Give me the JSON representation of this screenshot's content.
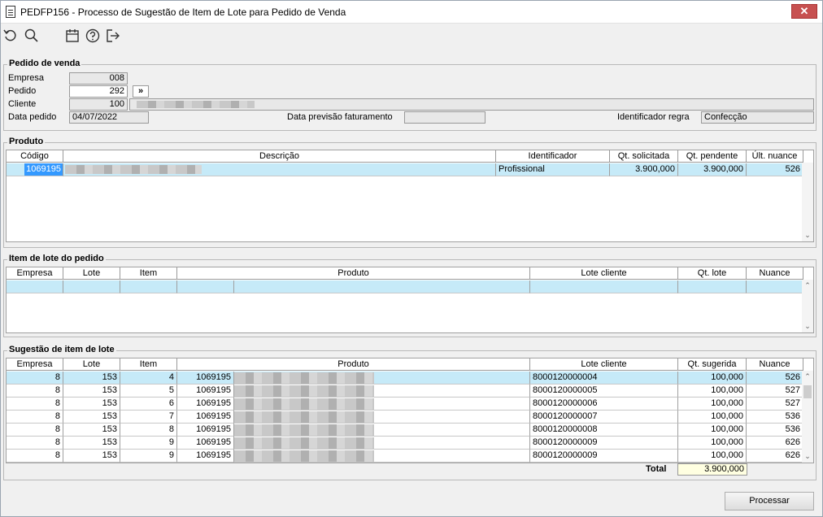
{
  "window": {
    "title": "PEDFP156 - Processo de Sugestão de Item de Lote para Pedido de Venda",
    "close": "✕"
  },
  "pedido": {
    "legend": "Pedido de venda",
    "empresa_label": "Empresa",
    "empresa_value": "008",
    "pedido_label": "Pedido",
    "pedido_value": "292",
    "pedido_btn": "»",
    "cliente_label": "Cliente",
    "cliente_value": "100",
    "data_label": "Data pedido",
    "data_value": "04/07/2022",
    "previsao_label": "Data previsão faturamento",
    "regra_label": "Identificador regra",
    "regra_value": "Confecção"
  },
  "produto": {
    "legend": "Produto",
    "headers": [
      "Código",
      "Descrição",
      "Identificador",
      "Qt. solicitada",
      "Qt. pendente",
      "Últ. nuance"
    ],
    "row": {
      "codigo": "1069195",
      "identificador": "Profissional",
      "solicitada": "3.900,000",
      "pendente": "3.900,000",
      "nuance": "526"
    }
  },
  "item_lote": {
    "legend": "Item de lote do pedido",
    "headers": [
      "Empresa",
      "Lote",
      "Item",
      "Produto",
      "Lote cliente",
      "Qt. lote",
      "Nuance"
    ]
  },
  "sugestao": {
    "legend": "Sugestão de item de lote",
    "headers": [
      "Empresa",
      "Lote",
      "Item",
      "Produto",
      "Lote cliente",
      "Qt. sugerida",
      "Nuance"
    ],
    "rows": [
      [
        "8",
        "153",
        "4",
        "1069195",
        "8000120000004",
        "100,000",
        "526"
      ],
      [
        "8",
        "153",
        "5",
        "1069195",
        "8000120000005",
        "100,000",
        "527"
      ],
      [
        "8",
        "153",
        "6",
        "1069195",
        "8000120000006",
        "100,000",
        "527"
      ],
      [
        "8",
        "153",
        "7",
        "1069195",
        "8000120000007",
        "100,000",
        "536"
      ],
      [
        "8",
        "153",
        "8",
        "1069195",
        "8000120000008",
        "100,000",
        "536"
      ],
      [
        "8",
        "153",
        "9",
        "1069195",
        "8000120000009",
        "100,000",
        "626"
      ],
      [
        "8",
        "153",
        "9",
        "1069195",
        "8000120000009",
        "100,000",
        "626"
      ]
    ],
    "total_label": "Total",
    "total_value": "3.900,000"
  },
  "actions": {
    "processar": "Processar"
  }
}
